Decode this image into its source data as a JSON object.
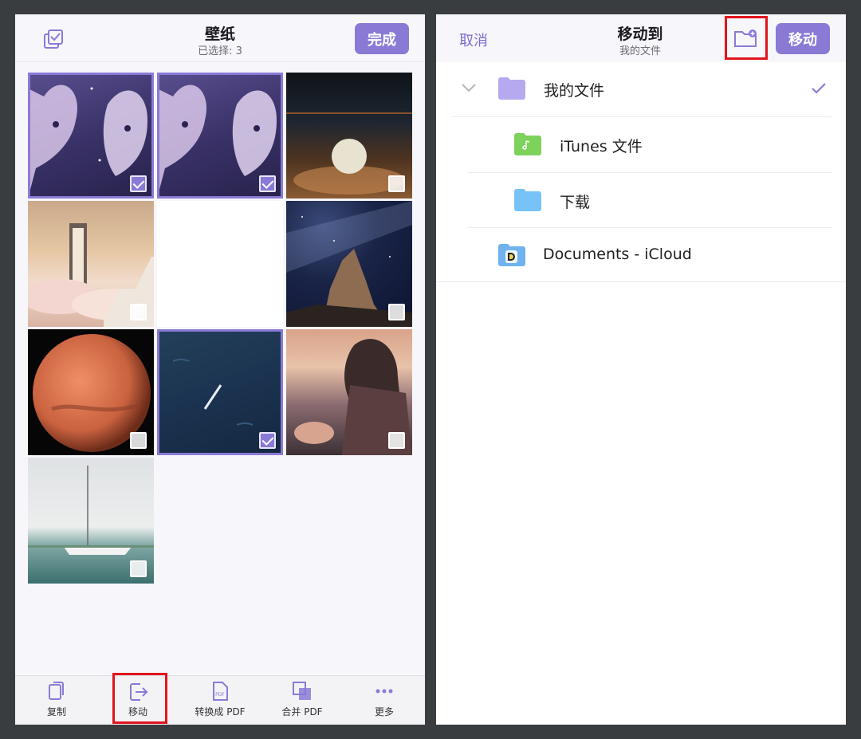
{
  "left": {
    "title": "壁纸",
    "subtitle": "已选择: 3",
    "done_label": "完成",
    "photos": [
      {
        "name": "dragon-art-1",
        "selected": true
      },
      {
        "name": "dragon-art-2",
        "selected": true
      },
      {
        "name": "moon-beach",
        "selected": false
      },
      {
        "name": "door-clouds",
        "selected": false
      },
      {
        "name": "blank",
        "selected": false
      },
      {
        "name": "rock-milkyway",
        "selected": false
      },
      {
        "name": "mars",
        "selected": false
      },
      {
        "name": "ocean-boat",
        "selected": true
      },
      {
        "name": "girl-sunset",
        "selected": false
      },
      {
        "name": "sailboat",
        "selected": false
      }
    ],
    "toolbar": {
      "copy": "复制",
      "move": "移动",
      "to_pdf": "转换成 PDF",
      "merge_pdf": "合并 PDF",
      "more": "更多"
    }
  },
  "right": {
    "cancel_label": "取消",
    "title": "移动到",
    "subtitle": "我的文件",
    "move_label": "移动",
    "folders": [
      {
        "label": "我的文件",
        "color": "#b7a9ef"
      },
      {
        "label": "iTunes 文件",
        "color": "#7dd25c"
      },
      {
        "label": "下载",
        "color": "#77c2f7"
      },
      {
        "label": "Documents - iCloud",
        "color": "#6fb3f0"
      }
    ]
  },
  "colors": {
    "accent": "#8a7ad6",
    "highlight": "#e3141b"
  }
}
